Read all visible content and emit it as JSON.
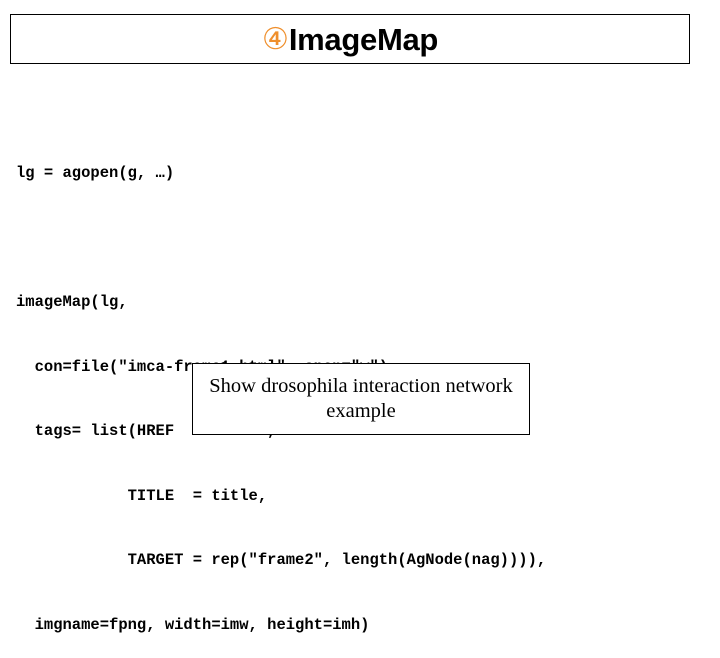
{
  "slide": {
    "title": {
      "bullet_glyph": "④",
      "bullet_icon_name": "circled-four-bullet-icon",
      "bullet_color": "#ef8f2c",
      "text": "ImageMap"
    },
    "code": {
      "language": "R",
      "lines": [
        "lg = agopen(g, …)",
        "",
        "imageMap(lg,",
        "  con=file(\"imca-frame1.html\", open=\"w\")",
        "  tags= list(HREF    = href,",
        "            TITLE  = title,",
        "            TARGET = rep(\"frame2\", length(AgNode(nag)))),",
        "  imgname=fpng, width=imw, height=imh)"
      ]
    },
    "button": {
      "label": "Show drosophila interaction network example"
    }
  }
}
